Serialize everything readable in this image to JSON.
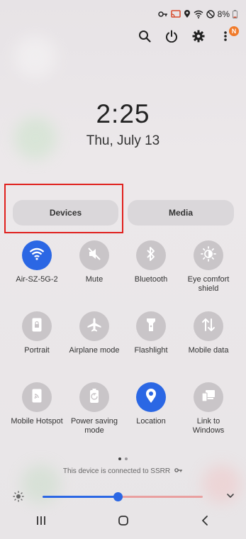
{
  "status_bar": {
    "battery_percent": "8%",
    "icons": [
      "key-icon",
      "cast-icon",
      "location-icon",
      "wifi-icon",
      "dnd-icon",
      "battery-icon"
    ]
  },
  "top_actions": {
    "notification_badge": "N",
    "icons": [
      "search-icon",
      "power-icon",
      "settings-icon",
      "more-icon"
    ]
  },
  "clock": {
    "time": "2:25",
    "date": "Thu, July 13"
  },
  "segments": {
    "devices_label": "Devices",
    "media_label": "Media"
  },
  "tiles": [
    {
      "label": "Air-SZ-5G-2",
      "icon": "wifi-icon",
      "active": true
    },
    {
      "label": "Mute",
      "icon": "mute-icon",
      "active": false
    },
    {
      "label": "Bluetooth",
      "icon": "bluetooth-icon",
      "active": false
    },
    {
      "label": "Eye comfort shield",
      "icon": "eye-comfort-icon",
      "active": false
    },
    {
      "label": "Portrait",
      "icon": "portrait-lock-icon",
      "active": false
    },
    {
      "label": "Airplane mode",
      "icon": "airplane-icon",
      "active": false
    },
    {
      "label": "Flashlight",
      "icon": "flashlight-icon",
      "active": false
    },
    {
      "label": "Mobile data",
      "icon": "mobile-data-icon",
      "active": false
    },
    {
      "label": "Mobile Hotspot",
      "icon": "hotspot-icon",
      "active": false
    },
    {
      "label": "Power saving mode",
      "icon": "power-saving-icon",
      "active": false
    },
    {
      "label": "Location",
      "icon": "location-pin-icon",
      "active": true
    },
    {
      "label": "Link to Windows",
      "icon": "link-windows-icon",
      "active": false
    }
  ],
  "page_indicator": {
    "current": 1,
    "total": 2
  },
  "connection": {
    "text": "This device is connected to SSRR"
  },
  "brightness": {
    "level": 0.47
  },
  "colors": {
    "accent": "#2b67e4",
    "tile_off": "#c9c5c8",
    "highlight_border": "#e0201d",
    "badge": "#f07a2a"
  },
  "navbar": {
    "icons": [
      "recent-apps-icon",
      "home-icon",
      "back-icon"
    ]
  }
}
